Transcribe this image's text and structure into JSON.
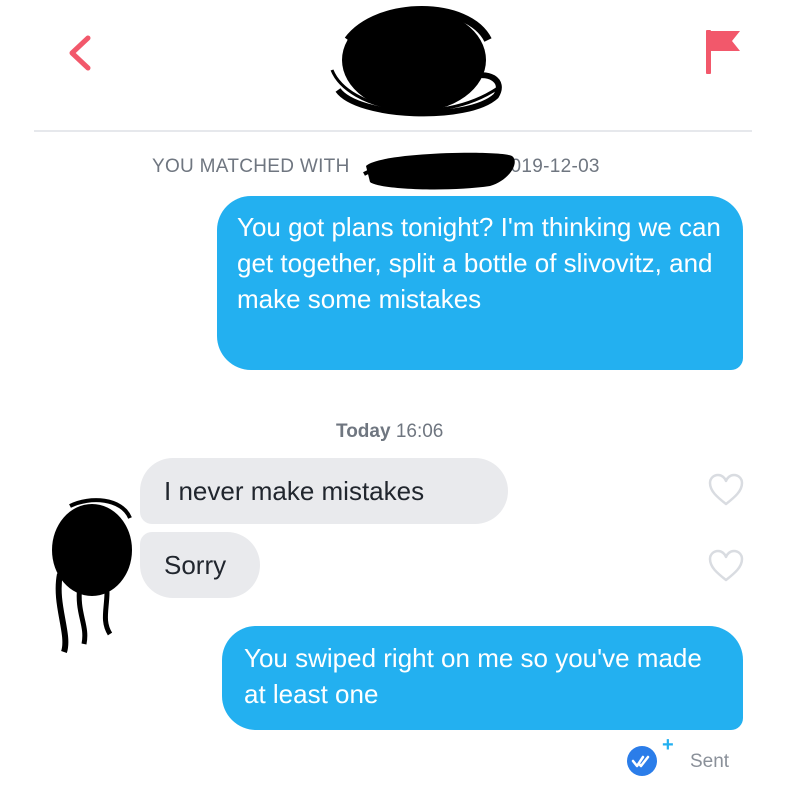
{
  "header": {
    "back_icon": "chevron-left-icon",
    "flag_icon": "flag-icon",
    "accent_color": "#f2586b"
  },
  "match": {
    "prefix": "YOU MATCHED WITH",
    "date": "2019-12-03"
  },
  "messages": [
    {
      "direction": "sent",
      "text": "You got plans tonight? I'm thinking we can get together, split a bottle of slivovitz, and make some mistakes"
    },
    {
      "direction": "received",
      "text": "I never make  mistakes"
    },
    {
      "direction": "received",
      "text": "Sorry"
    },
    {
      "direction": "sent",
      "text": "You swiped right on me so you've made at least one"
    }
  ],
  "separator": {
    "day": "Today",
    "time": "16:06"
  },
  "status": {
    "label": "Sent",
    "badge_plus": "+",
    "icon": "double-check-icon"
  },
  "colors": {
    "sent_bubble": "#23b0f0",
    "received_bubble": "#e9eaed"
  }
}
